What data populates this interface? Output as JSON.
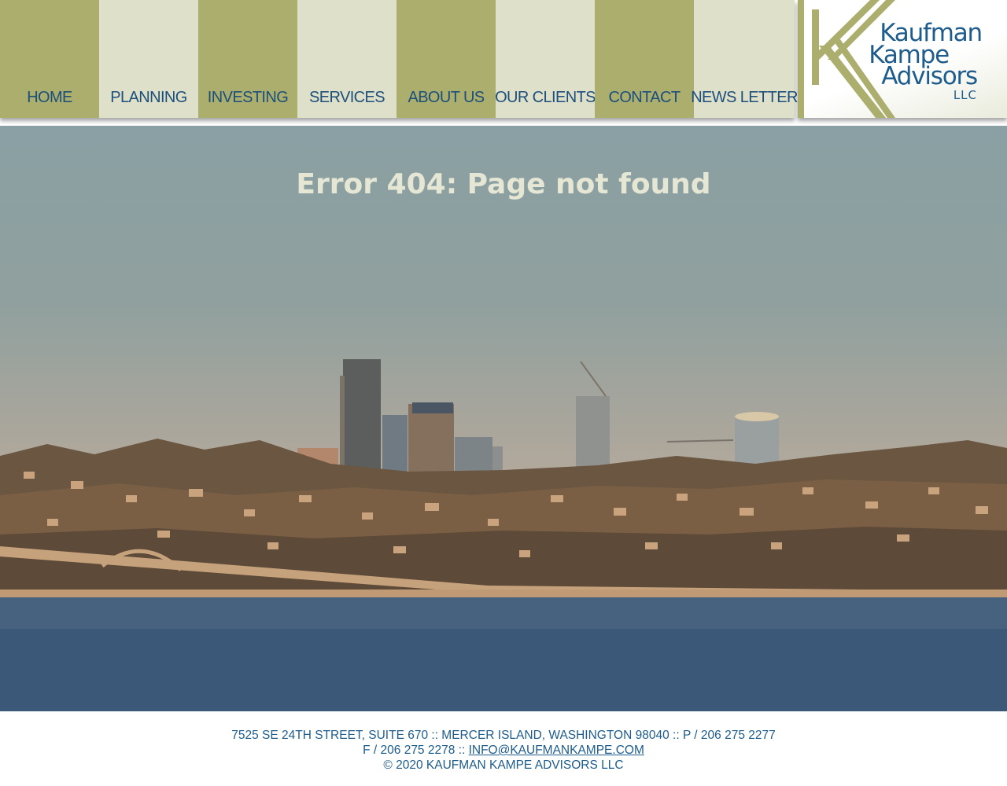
{
  "nav": {
    "items": [
      {
        "label": "HOME"
      },
      {
        "label": "PLANNING"
      },
      {
        "label": "INVESTING"
      },
      {
        "label": "SERVICES"
      },
      {
        "label": "ABOUT US"
      },
      {
        "label": "OUR CLIENTS"
      },
      {
        "label": "CONTACT"
      },
      {
        "label": "NEWS LETTER"
      }
    ]
  },
  "logo": {
    "line1": "Kaufman",
    "line2": "Kampe",
    "line3": "Advisors",
    "suffix": "LLC"
  },
  "main": {
    "title": "Error 404: Page not found"
  },
  "footer": {
    "address": "7525 SE 24TH STREET, SUITE 670 :: MERCER ISLAND, WASHINGTON 98040 :: P / 206 275 2277",
    "fax_prefix": "F / 206 275 2278 ::",
    "email": "INFO@KAUFMANKAMPE.COM",
    "copyright": "© 2020 KAUFMAN KAMPE ADVISORS LLC"
  },
  "colors": {
    "nav_dark": "#abae6c",
    "nav_light": "#dfe0c9",
    "text_blue": "#1d4f7c",
    "title_cream": "#e5e6d3"
  }
}
